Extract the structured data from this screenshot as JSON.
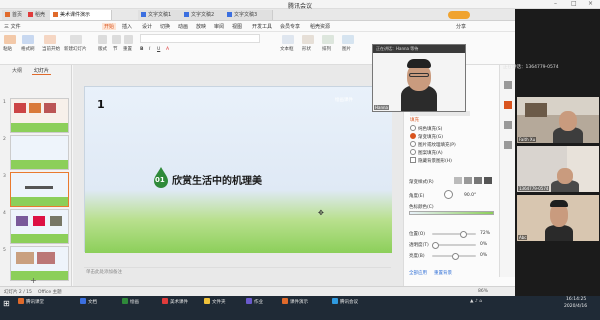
{
  "meeting": {
    "title": "腾讯会议",
    "top_speaker": "正在讲话：Hanna 等待"
  },
  "wps": {
    "tabs": [
      {
        "label": "首页",
        "color": "#e06a2b"
      },
      {
        "label": "稻壳",
        "color": "#e03b3b"
      },
      {
        "label": "美术课件演示",
        "color": "#e06a2b"
      },
      {
        "label": "文字文稿1",
        "color": "#3b6fe0"
      },
      {
        "label": "文字文稿2",
        "color": "#3b6fe0"
      },
      {
        "label": "文字文稿3",
        "color": "#3b6fe0"
      }
    ],
    "menus": [
      "三 文件",
      "开始",
      "插入",
      "设计",
      "切换",
      "动画",
      "放映",
      "审阅",
      "视图",
      "开发工具",
      "会员专享",
      "稻壳资源"
    ],
    "active_menu": "开始",
    "search_placeholder": "查找命令、搜索模板",
    "share": "分享",
    "toolbar": [
      "粘贴",
      "格式刷",
      "当前开始",
      "新建幻灯片",
      "版式",
      "节",
      "重置",
      "文本框",
      "形状",
      "排列",
      "图片"
    ],
    "panel_tabs": [
      "大纲",
      "幻灯片"
    ],
    "slide_numbers": [
      "1",
      "2",
      "3",
      "4",
      "5",
      "6"
    ],
    "slide": {
      "number": "1",
      "badge": "01",
      "title": "欣赏生活中的机理美",
      "corner": "绘画课件"
    },
    "notes_placeholder": "单击此处添加备注",
    "right": {
      "section": "填充",
      "options": [
        "纯色填充(S)",
        "渐变填充(G)",
        "图片或纹理填充(P)",
        "图案填充(A)",
        "隐藏背景图形(H)"
      ],
      "gradient_style": "渐变样式(R)",
      "angle_label": "角度(E)",
      "angle_value": "90.0°",
      "stops": "色标颜色(C)",
      "position_label": "位置(O)",
      "position_value": "72%",
      "transparency_label": "透明度(T)",
      "transparency_value": "0%",
      "brightness_label": "亮度(B)",
      "brightness_value": "0%",
      "apply_all": "全部应用",
      "reset": "重置背景"
    },
    "status": {
      "slide": "幻灯片 2 / 15",
      "theme": "Office 主题",
      "zoom": "86%"
    }
  },
  "video": {
    "presenter_label": "Hanna",
    "p1": "Faith Xu",
    "p2": "1364779-0574",
    "p3": "Abc",
    "panel_title": "正在讲话：1364779-0574"
  },
  "taskbar": {
    "items": [
      "腾讯课堂",
      "文档",
      "绘画",
      "美术课件",
      "文件夹",
      "作业",
      "课件演示",
      "腾讯会议"
    ],
    "clock_time": "16:14:25",
    "clock_date": "2020/4/16"
  },
  "colors": {
    "accent": "#e06a2b",
    "taskbar": "#1f2a36",
    "slide_green": "#8ccf5a",
    "slide_blue": "#dfe9f5"
  }
}
